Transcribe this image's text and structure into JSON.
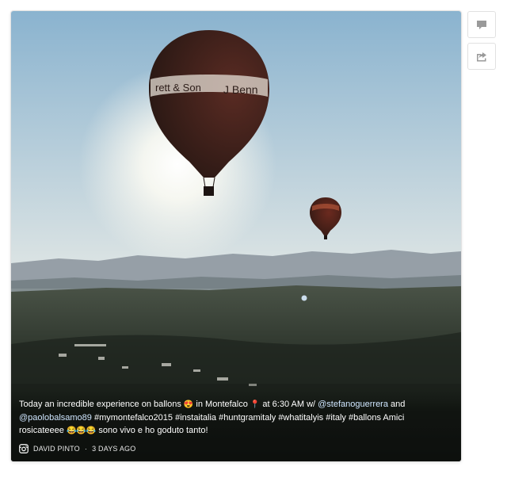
{
  "post": {
    "caption_parts": [
      {
        "type": "text",
        "value": "Today an incredible experience on ballons "
      },
      {
        "type": "emoji",
        "value": "😍"
      },
      {
        "type": "text",
        "value": " in Montefalco "
      },
      {
        "type": "emoji",
        "value": "📍"
      },
      {
        "type": "text",
        "value": " at 6:30 AM w/ "
      },
      {
        "type": "mention",
        "value": "@stefanoguerrera"
      },
      {
        "type": "text",
        "value": " and "
      },
      {
        "type": "mention",
        "value": "@paolobalsamo89"
      },
      {
        "type": "text",
        "value": " #mymontefalco2015 #instaitalia #huntgramitaly #whatitalyis #italy #ballons Amici rosicateeee "
      },
      {
        "type": "emoji",
        "value": "😂😂😂"
      },
      {
        "type": "text",
        "value": " sono vivo e ho goduto tanto!"
      }
    ],
    "author": "DAVID PINTO",
    "separator": "·",
    "time_ago": "3 DAYS AGO",
    "source_icon": "instagram-icon"
  },
  "balloon_large_text": [
    "rett & Son",
    "J Benn"
  ],
  "side_actions": [
    {
      "name": "comment-button",
      "icon": "comment-icon"
    },
    {
      "name": "share-button",
      "icon": "share-icon"
    }
  ],
  "colors": {
    "sky_top": "#8fb6d2",
    "sky_bottom": "#ece9df",
    "mountains": "#7f8b96",
    "land_dark": "#1f2620",
    "accent_mention": "#cfe6ff"
  }
}
